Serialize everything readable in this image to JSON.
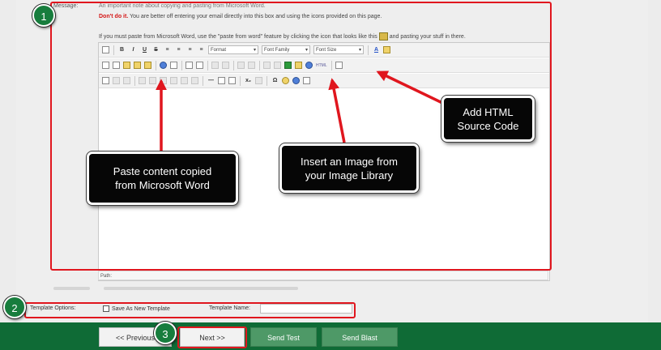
{
  "form": {
    "message_label": "Message:",
    "note_intro": "An important note about copying and pasting from Microsoft Word.",
    "note_warning": "Don't do it.",
    "note_warning_rest": " You are better off entering your email directly into this box and using the icons provided on this page.",
    "note_paste_before": "If you must paste from Microsoft Word, use the \"paste from word\" feature by clicking the icon that looks like this",
    "note_paste_after": "and pasting your stuff in there."
  },
  "editor": {
    "format_select": "Format",
    "font_family_select": "Font Family",
    "font_size_select": "Font Size",
    "html_button": "HTML",
    "path_label": "Path:"
  },
  "template": {
    "options_label": "Template Options:",
    "save_as_new_label": "Save As New Template",
    "name_label": "Template Name:"
  },
  "buttons": {
    "previous": "<< Previous",
    "next": "Next >>",
    "send_test": "Send Test",
    "send_blast": "Send Blast"
  },
  "annotations": {
    "badge1": "1",
    "badge2": "2",
    "badge3": "3",
    "paste_callout_line1": "Paste content copied",
    "paste_callout_line2": "from Microsoft Word",
    "image_callout_line1": "Insert an Image from",
    "image_callout_line2": "your Image Library",
    "html_callout_line1": "Add HTML",
    "html_callout_line2": "Source Code"
  },
  "colors": {
    "footer_green": "#0f6b36",
    "highlight_red": "#e0161e",
    "badge_green": "#177d3d",
    "send_button_green": "#4e9967",
    "warning_red": "#d41515"
  }
}
